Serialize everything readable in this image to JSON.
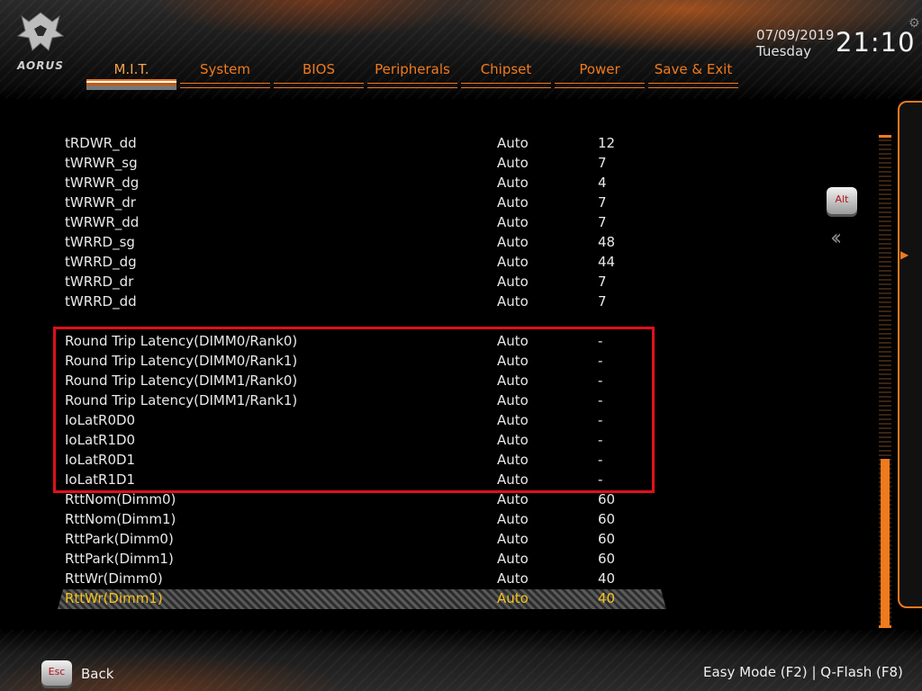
{
  "brand": {
    "logo_text": "AORUS"
  },
  "tabs": [
    {
      "label": "M.I.T.",
      "active": true
    },
    {
      "label": "System"
    },
    {
      "label": "BIOS"
    },
    {
      "label": "Peripherals"
    },
    {
      "label": "Chipset"
    },
    {
      "label": "Power"
    },
    {
      "label": "Save & Exit"
    }
  ],
  "datetime": {
    "date": "07/09/2019",
    "day": "Tuesday",
    "time": "21:10"
  },
  "settings": [
    {
      "name": "tRDWR_dd",
      "mode": "Auto",
      "value": "12"
    },
    {
      "name": "tWRWR_sg",
      "mode": "Auto",
      "value": "7"
    },
    {
      "name": "tWRWR_dg",
      "mode": "Auto",
      "value": "4"
    },
    {
      "name": "tWRWR_dr",
      "mode": "Auto",
      "value": "7"
    },
    {
      "name": "tWRWR_dd",
      "mode": "Auto",
      "value": "7"
    },
    {
      "name": "tWRRD_sg",
      "mode": "Auto",
      "value": "48"
    },
    {
      "name": "tWRRD_dg",
      "mode": "Auto",
      "value": "44"
    },
    {
      "name": "tWRRD_dr",
      "mode": "Auto",
      "value": "7"
    },
    {
      "name": "tWRRD_dd",
      "mode": "Auto",
      "value": "7"
    },
    {
      "name": "Round Trip Latency(DIMM0/Rank0)",
      "mode": "Auto",
      "value": "-"
    },
    {
      "name": "Round Trip Latency(DIMM0/Rank1)",
      "mode": "Auto",
      "value": "-"
    },
    {
      "name": "Round Trip Latency(DIMM1/Rank0)",
      "mode": "Auto",
      "value": "-"
    },
    {
      "name": "Round Trip Latency(DIMM1/Rank1)",
      "mode": "Auto",
      "value": "-"
    },
    {
      "name": "IoLatR0D0",
      "mode": "Auto",
      "value": "-"
    },
    {
      "name": "IoLatR1D0",
      "mode": "Auto",
      "value": "-"
    },
    {
      "name": "IoLatR0D1",
      "mode": "Auto",
      "value": "-"
    },
    {
      "name": "IoLatR1D1",
      "mode": "Auto",
      "value": "-"
    },
    {
      "name": "RttNom(Dimm0)",
      "mode": "Auto",
      "value": "60"
    },
    {
      "name": "RttNom(Dimm1)",
      "mode": "Auto",
      "value": "60"
    },
    {
      "name": "RttPark(Dimm0)",
      "mode": "Auto",
      "value": "60"
    },
    {
      "name": "RttPark(Dimm1)",
      "mode": "Auto",
      "value": "60"
    },
    {
      "name": "RttWr(Dimm0)",
      "mode": "Auto",
      "value": "40"
    },
    {
      "name": "RttWr(Dimm1)",
      "mode": "Auto",
      "value": "40",
      "selected": true
    }
  ],
  "keys": {
    "alt": "Alt",
    "esc": "Esc"
  },
  "footer": {
    "back_label": "Back",
    "easy_mode": "Easy Mode (F2)",
    "separator": "|",
    "qflash": "Q-Flash (F8)"
  },
  "colors": {
    "accent": "#f07a1e",
    "selected_text": "#f4c21c",
    "highlight_border": "#e0101a"
  }
}
